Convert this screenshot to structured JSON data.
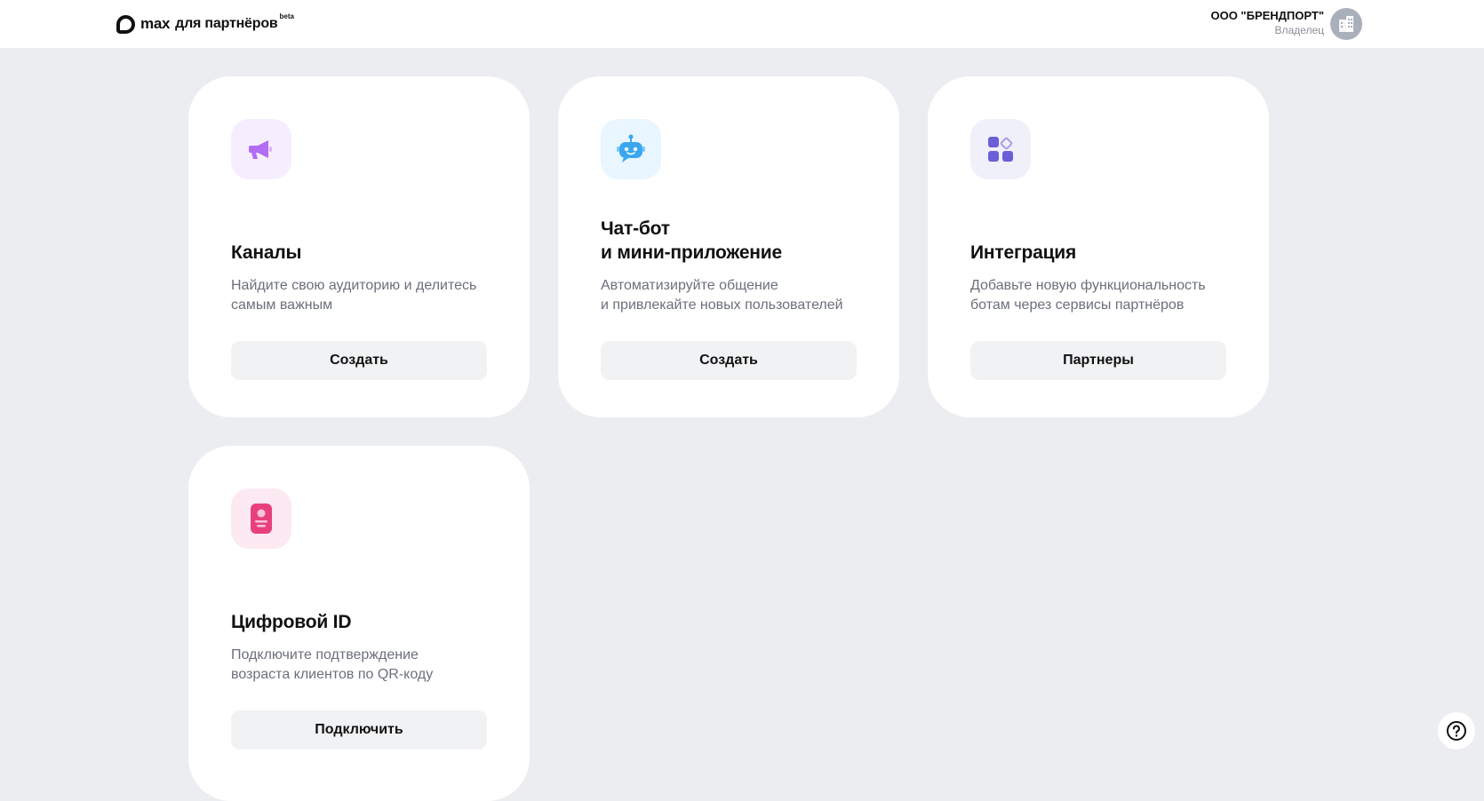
{
  "header": {
    "logo_word": "max",
    "logo_sub": "для партнёров",
    "logo_badge": "beta",
    "account_name": "ООО \"БРЕНДПОРТ\"",
    "account_role": "Владелец"
  },
  "cards": [
    {
      "title_line1": "Каналы",
      "title_line2": "",
      "desc_line1": "Найдите свою аудиторию и делитесь",
      "desc_line2": "самым важным",
      "button": "Создать",
      "icon": "megaphone-icon",
      "icon_bg": "#f6eeff",
      "icon_color": "#b26cf2"
    },
    {
      "title_line1": "Чат-бот",
      "title_line2": "и мини-приложение",
      "desc_line1": "Автоматизируйте общение",
      "desc_line2": "и привлекайте новых пользователей",
      "button": "Создать",
      "icon": "chatbot-icon",
      "icon_bg": "#e9f5ff",
      "icon_color": "#3aa7f0"
    },
    {
      "title_line1": "Интеграция",
      "title_line2": "",
      "desc_line1": "Добавьте новую функциональность",
      "desc_line2": "ботам через сервисы партнёров",
      "button": "Партнеры",
      "icon": "apps-grid-icon",
      "icon_bg": "#f0f0fb",
      "icon_color": "#6a5fd6"
    },
    {
      "title_line1": "Цифровой ID",
      "title_line2": "",
      "desc_line1": "Подключите подтверждение",
      "desc_line2": "возраста клиентов по QR-коду",
      "button": "Подключить",
      "icon": "id-card-icon",
      "icon_bg": "#fde9f1",
      "icon_color": "#e8407d"
    }
  ],
  "help": {
    "icon": "help-icon"
  }
}
